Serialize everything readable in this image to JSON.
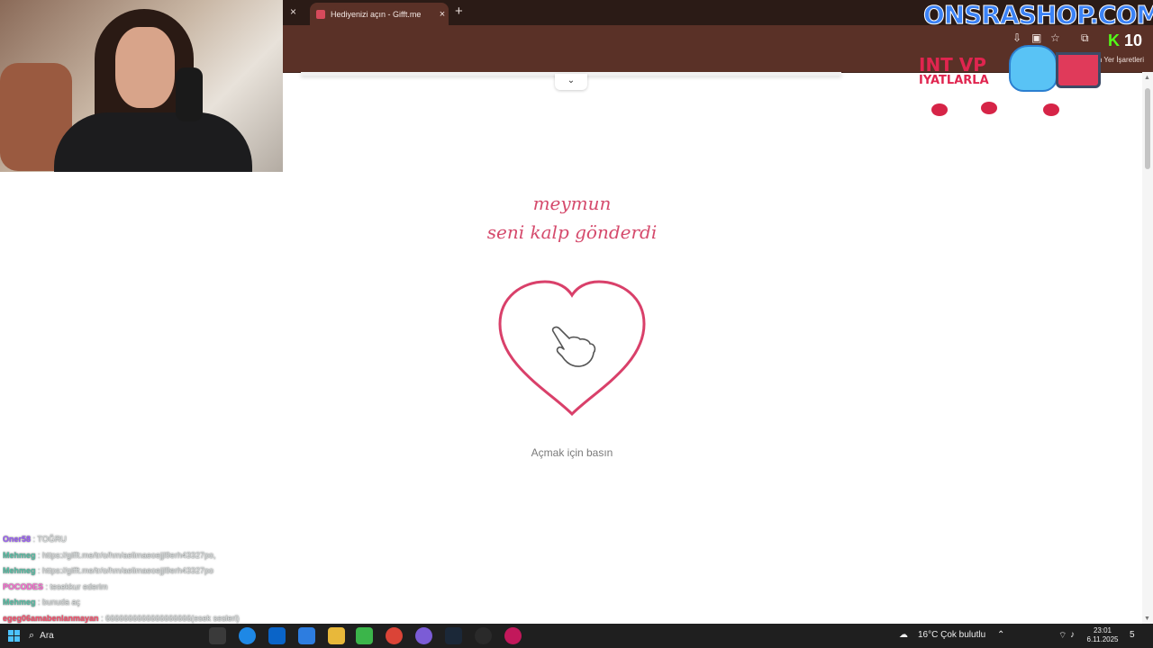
{
  "browser": {
    "tab_title": "Hediyenizi açın - Gifft.me",
    "tab_close": "×",
    "window_close": "×",
    "new_tab": "+",
    "bookmarks_label": "am Yer İşaretleri"
  },
  "overlay": {
    "watermark": "ONSRASHOP.COM",
    "kick_prefix": "K",
    "kick_count": "10",
    "promo_line1": "INT VP",
    "promo_line2": "IYATLARLA"
  },
  "page": {
    "sender": "meymun",
    "message": "seni kalp gönderdi",
    "hint": "Açmak için basın",
    "collapse_icon": "⌄",
    "accent": "#d54a6c"
  },
  "chat": [
    {
      "user": "Oner58",
      "user_color": "#9b59ff",
      "text": " : TOĞRU"
    },
    {
      "user": "Mehmeg",
      "user_color": "#55c1a6",
      "text": " : https://gifft.me/tr/o/hm/aelimaeoejjl9erh43327po,"
    },
    {
      "user": "Mehmeg",
      "user_color": "#55c1a6",
      "text": " : https://gifft.me/tr/o/hm/aelimaeoejjl9erh43327po"
    },
    {
      "user": "POCODES",
      "user_color": "#ff6ad5",
      "text": " : tesekkur ederim"
    },
    {
      "user": "Mehmeg",
      "user_color": "#55c1a6",
      "text": " : bunuda aç"
    },
    {
      "user": "egeg06amabenlanmayan",
      "user_color": "#ff4f6d",
      "text": " : 6666666666666666666(esek sesleri)"
    }
  ],
  "taskbar": {
    "search_label": "Ara",
    "weather": "16°C  Çok bulutlu",
    "time": "23:01",
    "date": "6.11.2025",
    "notification_count": "5"
  }
}
